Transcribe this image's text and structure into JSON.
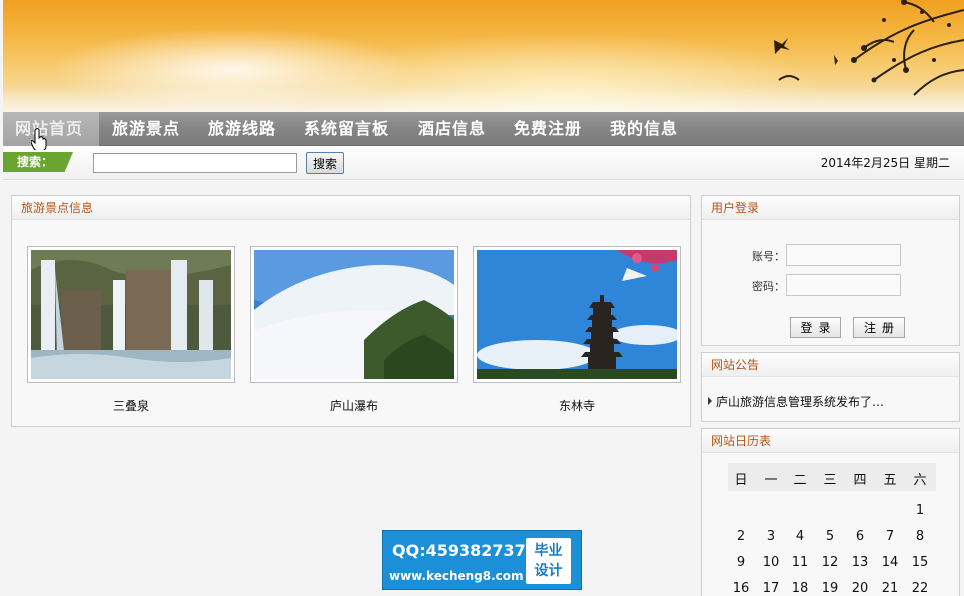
{
  "nav": {
    "items": [
      "网站首页",
      "旅游景点",
      "旅游线路",
      "系统留言板",
      "酒店信息",
      "免费注册",
      "我的信息"
    ]
  },
  "search": {
    "label": "搜索：",
    "value": "",
    "button": "搜索"
  },
  "date": "2014年2月25日  星期二",
  "spots": {
    "title": "旅游景点信息",
    "items": [
      {
        "name": "三叠泉"
      },
      {
        "name": "庐山瀑布"
      },
      {
        "name": "东林寺"
      }
    ]
  },
  "login": {
    "title": "用户登录",
    "account_label": "账号：",
    "password_label": "密码：",
    "login_button": "登录",
    "register_button": "注册"
  },
  "notice": {
    "title": "网站公告",
    "items": [
      "庐山旅游信息管理系统发布了…"
    ]
  },
  "calendar": {
    "title": "网站日历表",
    "weekdays": [
      "日",
      "一",
      "二",
      "三",
      "四",
      "五",
      "六"
    ],
    "rows": [
      [
        "",
        "",
        "",
        "",
        "",
        "",
        "1"
      ],
      [
        "2",
        "3",
        "4",
        "5",
        "6",
        "7",
        "8"
      ],
      [
        "9",
        "10",
        "11",
        "12",
        "13",
        "14",
        "15"
      ],
      [
        "16",
        "17",
        "18",
        "19",
        "20",
        "21",
        "22"
      ]
    ]
  },
  "watermark": {
    "qq": "QQ:459382737",
    "url": "www.kecheng8.com",
    "badge_line1": "毕业",
    "badge_line2": "设计"
  },
  "colors": {
    "accent": "#b5561a",
    "nav_bg": "#858585",
    "search_tag": "#6aa532",
    "watermark": "#1b8fd8"
  }
}
